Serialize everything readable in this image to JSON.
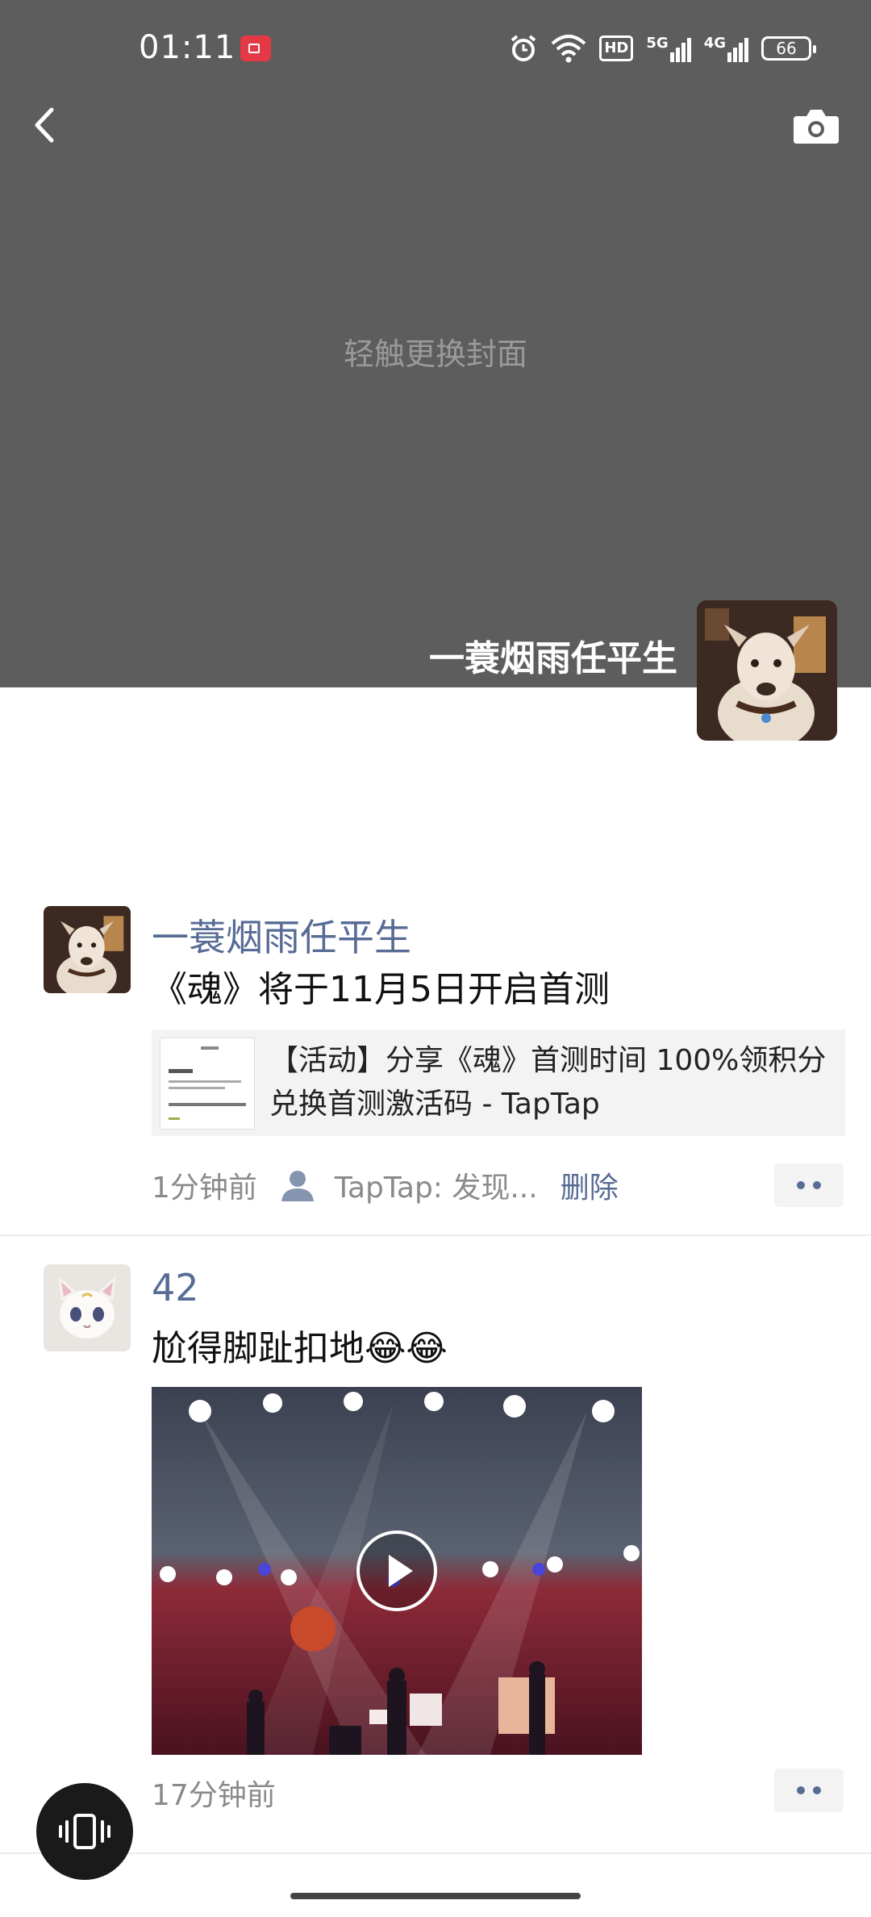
{
  "status_bar": {
    "time": "01:11",
    "hd_label": "HD",
    "network_5g": "5G",
    "network_4g": "4G",
    "battery": "66"
  },
  "cover": {
    "hint": "轻触更换封面",
    "background_color": "#5d5d5d"
  },
  "profile": {
    "name": "一蓑烟雨任平生"
  },
  "posts": [
    {
      "author": "一蓑烟雨任平生",
      "text": "《魂》将于11月5日开启首测",
      "link": {
        "title": "【活动】分享《魂》首测时间 100%领积分兑换首测激活码 - TapTap"
      },
      "time": "1分钟前",
      "source": "TapTap: 发现...",
      "delete_label": "删除"
    },
    {
      "author": "42",
      "text": "尬得脚趾扣地😂😂",
      "time": "17分钟前"
    }
  ],
  "colors": {
    "author_link": "#576b95",
    "meta_text": "#8a8a8a"
  }
}
